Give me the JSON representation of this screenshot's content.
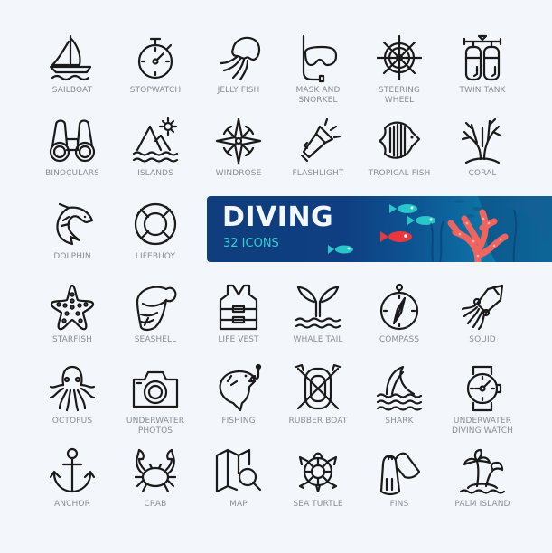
{
  "banner": {
    "title": "DIVING",
    "subtitle": "32 ICONS",
    "colors": {
      "background": "#0f3f82",
      "subtitle": "#2fd0d6",
      "coral": "#f0645f",
      "fish_teal": "#27c7c9",
      "fish_red": "#e8383d"
    }
  },
  "icons": [
    {
      "id": "sailboat",
      "label": "SAILBOAT"
    },
    {
      "id": "stopwatch",
      "label": "STOPWATCH"
    },
    {
      "id": "jelly-fish",
      "label": "JELLY FISH"
    },
    {
      "id": "mask-and-snorkel",
      "label": "MASK AND\nSNORKEL"
    },
    {
      "id": "steering-wheel",
      "label": "STEERING\nWHEEL"
    },
    {
      "id": "twin-tank",
      "label": "TWIN TANK"
    },
    {
      "id": "binoculars",
      "label": "BINOCULARS"
    },
    {
      "id": "islands",
      "label": "ISLANDS"
    },
    {
      "id": "windrose",
      "label": "WINDROSE"
    },
    {
      "id": "flashlight",
      "label": "FLASHLIGHT"
    },
    {
      "id": "tropical-fish",
      "label": "TROPICAL FISH"
    },
    {
      "id": "coral",
      "label": "CORAL"
    },
    {
      "id": "dolphin",
      "label": "DOLPHIN"
    },
    {
      "id": "lifebuoy",
      "label": "LIFEBUOY"
    },
    {
      "id": "starfish",
      "label": "STARFISH"
    },
    {
      "id": "seashell",
      "label": "SEASHELL"
    },
    {
      "id": "life-vest",
      "label": "LIFE VEST"
    },
    {
      "id": "whale-tail",
      "label": "WHALE TAIL"
    },
    {
      "id": "compass",
      "label": "COMPASS"
    },
    {
      "id": "squid",
      "label": "SQUID"
    },
    {
      "id": "octopus",
      "label": "OCTOPUS"
    },
    {
      "id": "underwater-photos",
      "label": "UNDERWATER\nPHOTOS"
    },
    {
      "id": "fishing",
      "label": "FISHING"
    },
    {
      "id": "rubber-boat",
      "label": "RUBBER BOAT"
    },
    {
      "id": "shark",
      "label": "SHARK"
    },
    {
      "id": "underwater-diving-watch",
      "label": "UNDERWATER\nDIVING WATCH"
    },
    {
      "id": "anchor",
      "label": "ANCHOR"
    },
    {
      "id": "crab",
      "label": "CRAB"
    },
    {
      "id": "map",
      "label": "MAP"
    },
    {
      "id": "sea-turtle",
      "label": "SEA TURTLE"
    },
    {
      "id": "fins",
      "label": "FINS"
    },
    {
      "id": "palm-island",
      "label": "PALM ISLAND"
    }
  ]
}
